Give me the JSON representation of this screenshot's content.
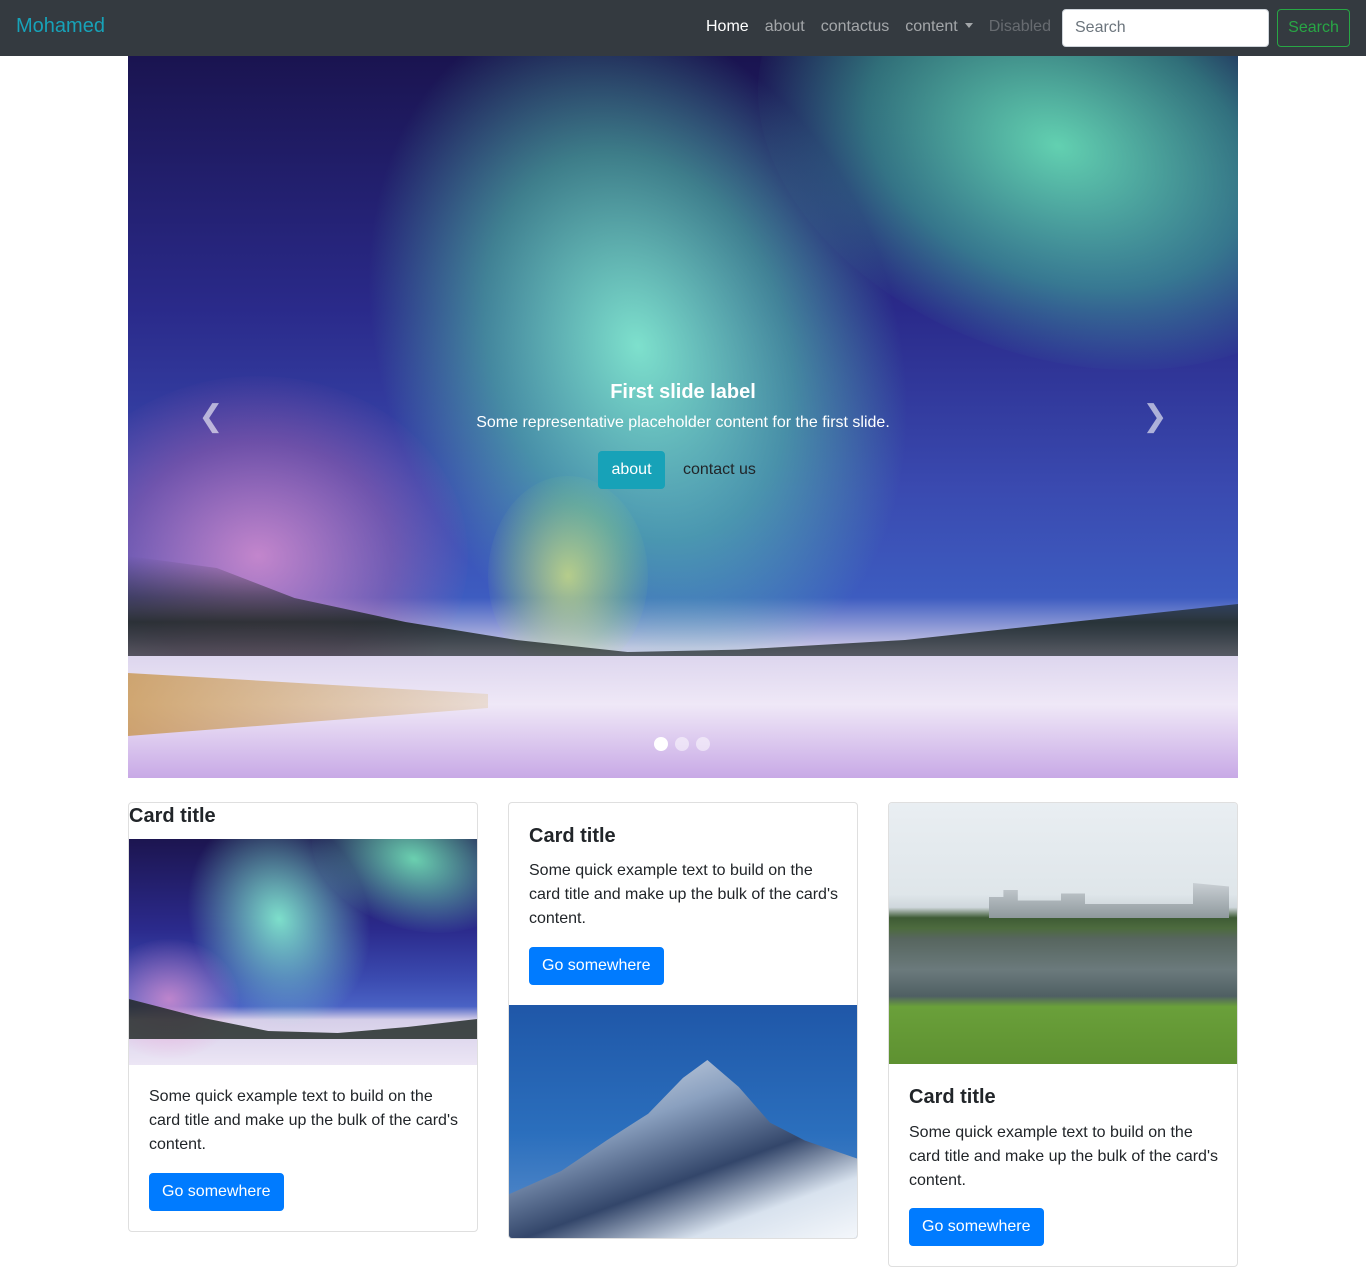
{
  "navbar": {
    "brand": "Mohamed",
    "links": [
      {
        "label": "Home"
      },
      {
        "label": "about"
      },
      {
        "label": "contactus"
      },
      {
        "label": "content"
      },
      {
        "label": "Disabled"
      }
    ],
    "search_placeholder": "Search",
    "search_button": "Search"
  },
  "carousel": {
    "caption_title": "First slide label",
    "caption_text": "Some representative placeholder content for the first slide.",
    "btn_about": "about",
    "btn_contact": "contact us",
    "slide_count": 3,
    "active_slide": 1
  },
  "cards": [
    {
      "title": "Card title",
      "text": "Some quick example text to build on the card title and make up the bulk of the card's content.",
      "button": "Go somewhere"
    },
    {
      "title": "Card title",
      "text": "Some quick example text to build on the card title and make up the bulk of the card's content.",
      "button": "Go somewhere"
    },
    {
      "title": "Card title",
      "text": "Some quick example text to build on the card title and make up the bulk of the card's content.",
      "button": "Go somewhere"
    }
  ],
  "colors": {
    "navbar_bg": "#343a40",
    "brand": "#17a2b8",
    "primary": "#007bff",
    "success": "#28a745",
    "info": "#17a2b8"
  }
}
